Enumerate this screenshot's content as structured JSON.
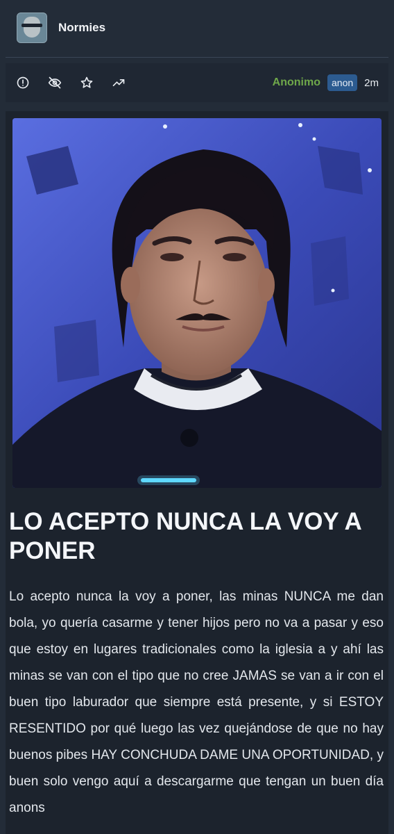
{
  "board": {
    "name": "Normies",
    "avatar_icon": "npc-face-icon"
  },
  "actions": {
    "icons": [
      "alert-circle-icon",
      "eye-off-icon",
      "star-icon",
      "trending-up-icon"
    ]
  },
  "meta": {
    "author": "Anonimo",
    "badge": "anon",
    "time": "2m"
  },
  "post": {
    "title": "LO ACEPTO NUNCA LA VOY A PONER",
    "body": "Lo acepto nunca la voy a poner, las minas NUNCA me dan bola, yo quería casarme y tener hijos pero no va a pasar y eso que estoy en lugares tradicionales como la iglesia a y ahí las minas se van con el tipo que no cree JAMAS se van a ir con el buen tipo laburador que siempre está presente, y si ESTOY RESENTIDO por qué luego las vez quejándose de que no hay buenos pibes HAY CONCHUDA DAME UNA OPORTUNIDAD, y buen solo vengo aquí a descargarme que tengan un buen día anons"
  },
  "colors": {
    "background": "#232c38",
    "author": "#6fa84a",
    "badge": "#2c5b90"
  }
}
